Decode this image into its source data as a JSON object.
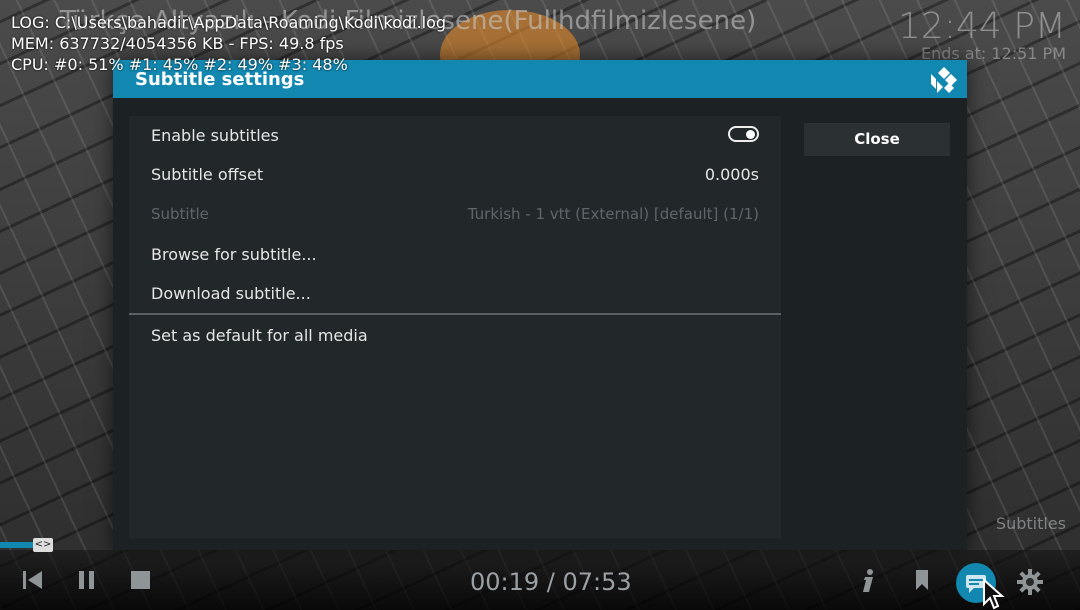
{
  "background": {
    "title": "Türkçe Altyazılı - Kodi Filmizlesene(Fullhdfilmizlesene)",
    "clock": "12:44 PM",
    "ends_at": "Ends at: 12:51 PM"
  },
  "debug": {
    "log": "LOG: C:\\Users\\bahadir\\AppData\\Roaming\\Kodi\\kodi.log",
    "mem": "MEM: 637732/4054356 KB - FPS: 49.8 fps",
    "cpu": "CPU: #0:  51% #1:  45% #2:  49% #3:  48%"
  },
  "dialog": {
    "title": "Subtitle settings",
    "close_label": "Close",
    "items": [
      {
        "label": "Enable subtitles",
        "value": "",
        "toggle": true
      },
      {
        "label": "Subtitle offset",
        "value": "0.000s"
      },
      {
        "label": "Subtitle",
        "value": "Turkish - 1 vtt (External) [default] (1/1)",
        "disabled": true
      },
      {
        "label": "Browse for subtitle...",
        "value": ""
      },
      {
        "label": "Download subtitle...",
        "value": ""
      },
      {
        "label": "Set as default for all media",
        "value": ""
      }
    ]
  },
  "osd": {
    "time": "00:19 / 07:53",
    "progress_fraction": 0.04,
    "progress_knob_text": "<>",
    "subtitles_label": "Subtitles"
  },
  "colors": {
    "accent": "#1287b0",
    "dialog_bg": "#1c2124"
  },
  "icons": [
    "skip-back-icon",
    "pause-icon",
    "stop-icon",
    "info-icon",
    "bookmark-icon",
    "subtitles-icon",
    "settings-icon",
    "kodi-logo-icon",
    "mouse-cursor-icon"
  ]
}
